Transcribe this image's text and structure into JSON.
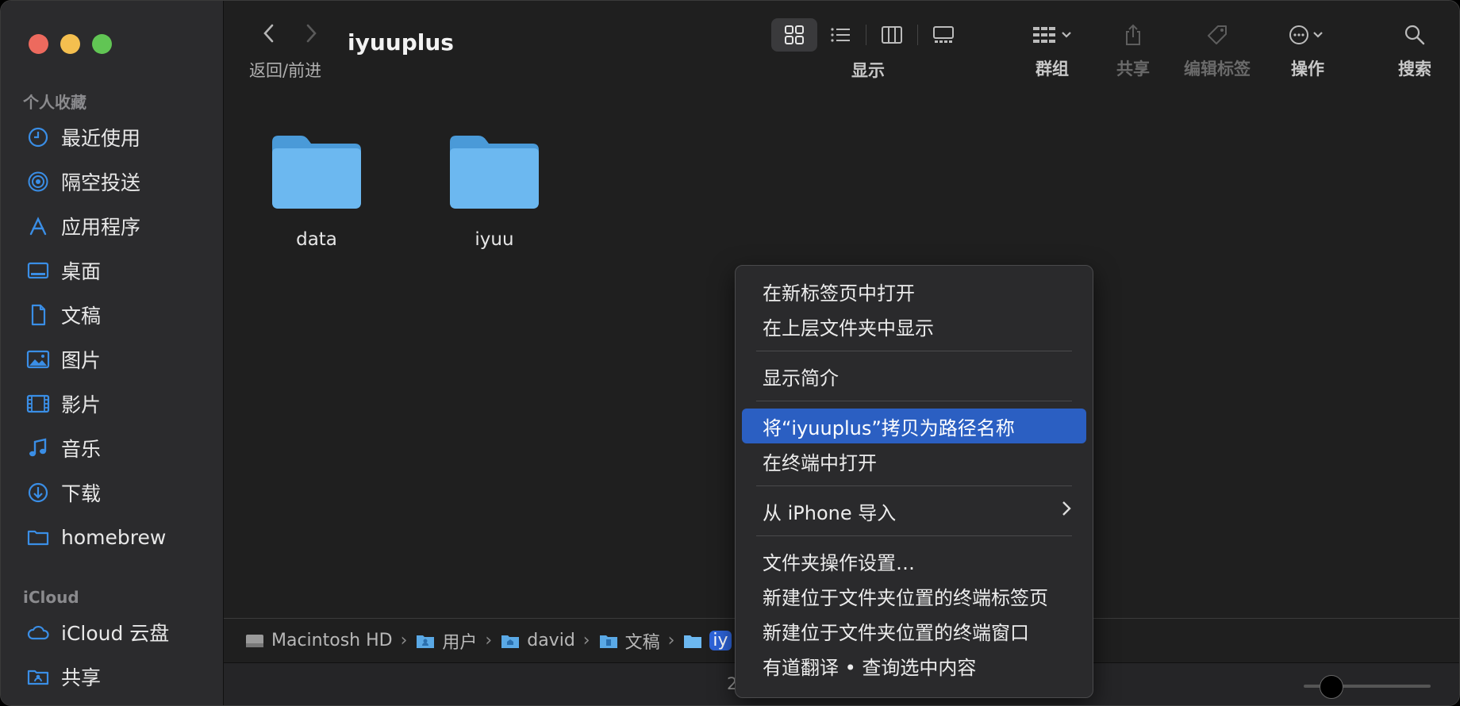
{
  "window": {
    "title": "iyuuplus"
  },
  "sidebar": {
    "favorites_header": "个人收藏",
    "favorites": [
      {
        "label": "最近使用",
        "icon": "clock-icon"
      },
      {
        "label": "隔空投送",
        "icon": "airdrop-icon"
      },
      {
        "label": "应用程序",
        "icon": "applications-icon"
      },
      {
        "label": "桌面",
        "icon": "desktop-icon"
      },
      {
        "label": "文稿",
        "icon": "document-icon"
      },
      {
        "label": "图片",
        "icon": "photo-icon"
      },
      {
        "label": "影片",
        "icon": "film-icon"
      },
      {
        "label": "音乐",
        "icon": "music-icon"
      },
      {
        "label": "下载",
        "icon": "download-icon"
      },
      {
        "label": "homebrew",
        "icon": "folder-icon"
      }
    ],
    "icloud_header": "iCloud",
    "icloud": [
      {
        "label": "iCloud 云盘",
        "icon": "cloud-icon"
      },
      {
        "label": "共享",
        "icon": "shared-folder-icon"
      }
    ]
  },
  "toolbar": {
    "back_forward_label": "返回/前进",
    "view_label": "显示",
    "group_label": "群组",
    "share_label": "共享",
    "edit_tags_label": "编辑标签",
    "action_label": "操作",
    "search_label": "搜索"
  },
  "content": {
    "folders": [
      {
        "name": "data"
      },
      {
        "name": "iyuu"
      }
    ]
  },
  "pathbar": {
    "items": [
      "Macintosh HD",
      "用户",
      "david",
      "文稿",
      "iy"
    ]
  },
  "statusbar": {
    "text": "2"
  },
  "context_menu": {
    "items": [
      "在新标签页中打开",
      "在上层文件夹中显示",
      "显示简介",
      "将“iyuuplus”拷贝为路径名称",
      "在终端中打开",
      "从 iPhone 导入",
      "文件夹操作设置…",
      "新建位于文件夹位置的终端标签页",
      "新建位于文件夹位置的终端窗口",
      "有道翻译 • 查询选中内容"
    ]
  },
  "colors": {
    "accent": "#2b5fc2",
    "folder": "#6cb8f0",
    "sidebar_icon": "#3a8ee6"
  }
}
